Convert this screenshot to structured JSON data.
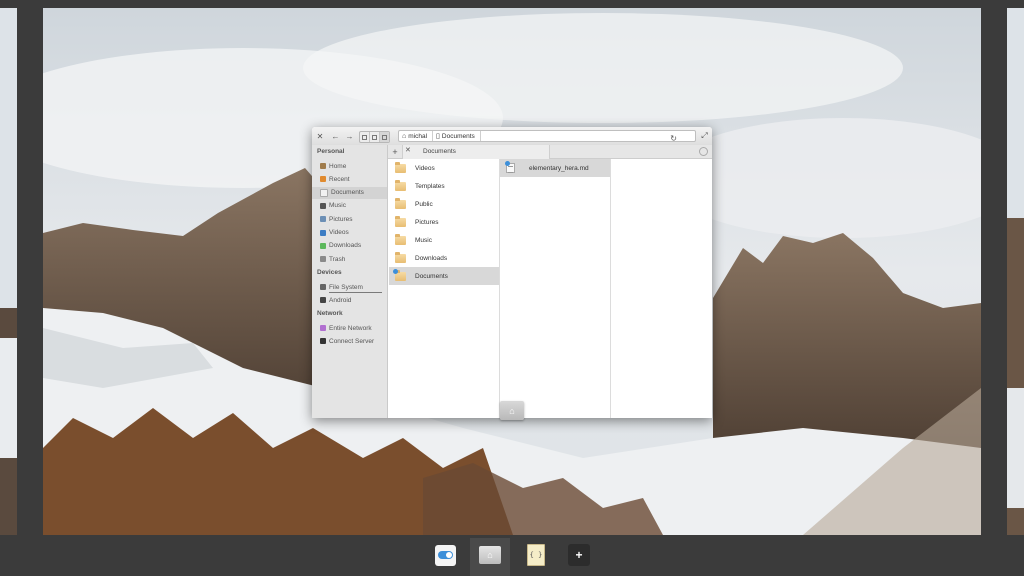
{
  "window": {
    "path": [
      "michal",
      "Documents"
    ],
    "tab_label": "Documents"
  },
  "sidebar": {
    "personal_header": "Personal",
    "personal": [
      {
        "label": "Home",
        "icon": "home-icon",
        "color": "#a07c4c"
      },
      {
        "label": "Recent",
        "icon": "recent-icon",
        "color": "#e08a2e"
      },
      {
        "label": "Documents",
        "icon": "document-icon",
        "color": "#f2f2f2"
      },
      {
        "label": "Music",
        "icon": "music-icon",
        "color": "#555555"
      },
      {
        "label": "Pictures",
        "icon": "pictures-icon",
        "color": "#6c8fb5"
      },
      {
        "label": "Videos",
        "icon": "videos-icon",
        "color": "#3d7dc4"
      },
      {
        "label": "Downloads",
        "icon": "downloads-icon",
        "color": "#5cb85c"
      },
      {
        "label": "Trash",
        "icon": "trash-icon",
        "color": "#8a8a8a"
      }
    ],
    "devices_header": "Devices",
    "devices": [
      {
        "label": "File System",
        "icon": "drive-icon",
        "color": "#666666"
      },
      {
        "label": "Android",
        "icon": "phone-icon",
        "color": "#444444"
      }
    ],
    "network_header": "Network",
    "network": [
      {
        "label": "Entire Network",
        "icon": "network-icon",
        "color": "#b16fd0"
      },
      {
        "label": "Connect Server",
        "icon": "server-icon",
        "color": "#333333"
      }
    ]
  },
  "folders": [
    {
      "label": "Videos",
      "icon": "folder-videos-icon"
    },
    {
      "label": "Templates",
      "icon": "folder-templates-icon"
    },
    {
      "label": "Public",
      "icon": "folder-public-icon"
    },
    {
      "label": "Pictures",
      "icon": "folder-pictures-icon"
    },
    {
      "label": "Music",
      "icon": "folder-music-icon"
    },
    {
      "label": "Downloads",
      "icon": "folder-downloads-icon"
    },
    {
      "label": "Documents",
      "icon": "folder-documents-icon"
    }
  ],
  "files": [
    {
      "label": "elementary_hera.md",
      "icon": "text-file-icon"
    }
  ],
  "dock": [
    "switch-app-icon",
    "files-app-icon",
    "code-app-icon",
    "add-workspace-icon"
  ]
}
